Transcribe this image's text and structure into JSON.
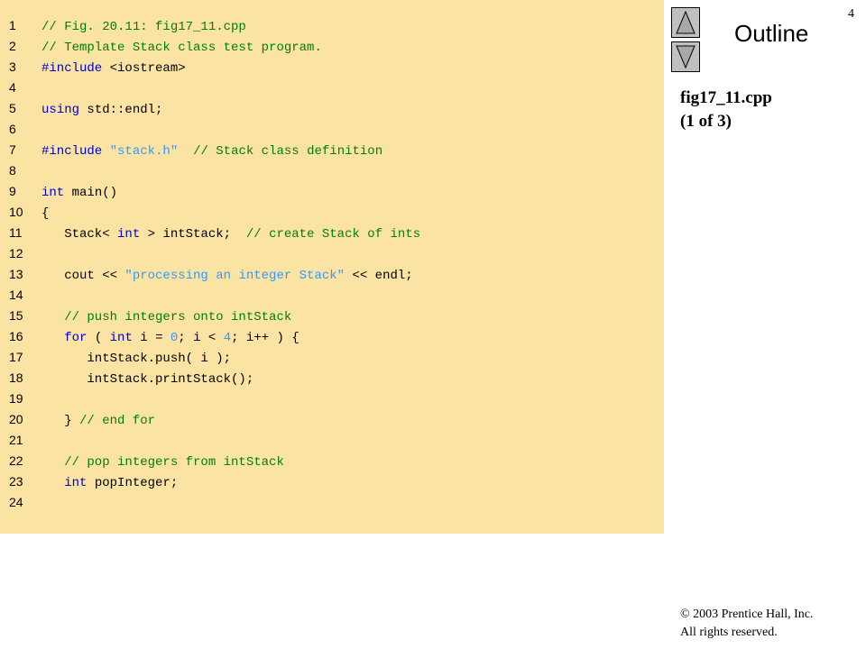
{
  "slide": {
    "number": "4",
    "outline_label": "Outline",
    "file_name": "fig17_11.cpp",
    "part": "(1 of 3)",
    "copyright_line1": "© 2003 Prentice Hall, Inc.",
    "copyright_line2": "All rights reserved."
  },
  "icons": {
    "up": "triangle-up-icon",
    "down": "triangle-down-icon"
  },
  "colors": {
    "panel_background": "#fbe3a3",
    "comment": "#008000",
    "keyword": "#0000cc",
    "string": "#3399ff",
    "number": "#3399ff",
    "button": "#c0c0c0"
  },
  "code_lines": [
    {
      "n": "1",
      "tokens": [
        {
          "t": "// Fig. 20.11: fig17_11.cpp",
          "c": "comment"
        }
      ]
    },
    {
      "n": "2",
      "tokens": [
        {
          "t": "// Template Stack class test program.",
          "c": "comment"
        }
      ]
    },
    {
      "n": "3",
      "tokens": [
        {
          "t": "#include",
          "c": "keyword"
        },
        {
          "t": " <iostream>",
          "c": "plain"
        }
      ]
    },
    {
      "n": "4",
      "tokens": []
    },
    {
      "n": "5",
      "tokens": [
        {
          "t": "using",
          "c": "keyword"
        },
        {
          "t": " std::endl;",
          "c": "plain"
        }
      ]
    },
    {
      "n": "6",
      "tokens": []
    },
    {
      "n": "7",
      "tokens": [
        {
          "t": "#include",
          "c": "keyword"
        },
        {
          "t": " ",
          "c": "plain"
        },
        {
          "t": "\"stack.h\"",
          "c": "string"
        },
        {
          "t": "  ",
          "c": "plain"
        },
        {
          "t": "// Stack class definition",
          "c": "comment"
        }
      ]
    },
    {
      "n": "8",
      "tokens": []
    },
    {
      "n": "9",
      "tokens": [
        {
          "t": "int",
          "c": "keyword"
        },
        {
          "t": " main()",
          "c": "plain"
        }
      ]
    },
    {
      "n": "10",
      "tokens": [
        {
          "t": "{",
          "c": "plain"
        }
      ]
    },
    {
      "n": "11",
      "tokens": [
        {
          "t": "   Stack< ",
          "c": "plain"
        },
        {
          "t": "int",
          "c": "keyword"
        },
        {
          "t": " > intStack;  ",
          "c": "plain"
        },
        {
          "t": "// create Stack of ints",
          "c": "comment"
        }
      ]
    },
    {
      "n": "12",
      "tokens": []
    },
    {
      "n": "13",
      "tokens": [
        {
          "t": "   cout << ",
          "c": "plain"
        },
        {
          "t": "\"processing an integer Stack\"",
          "c": "string"
        },
        {
          "t": " << endl;",
          "c": "plain"
        }
      ]
    },
    {
      "n": "14",
      "tokens": []
    },
    {
      "n": "15",
      "tokens": [
        {
          "t": "   // push integers onto intStack",
          "c": "comment"
        }
      ]
    },
    {
      "n": "16",
      "tokens": [
        {
          "t": "   ",
          "c": "plain"
        },
        {
          "t": "for",
          "c": "keyword"
        },
        {
          "t": " ( ",
          "c": "plain"
        },
        {
          "t": "int",
          "c": "keyword"
        },
        {
          "t": " i = ",
          "c": "plain"
        },
        {
          "t": "0",
          "c": "number"
        },
        {
          "t": "; i < ",
          "c": "plain"
        },
        {
          "t": "4",
          "c": "number"
        },
        {
          "t": "; i++ ) {",
          "c": "plain"
        }
      ]
    },
    {
      "n": "17",
      "tokens": [
        {
          "t": "      intStack.push( i );",
          "c": "plain"
        }
      ]
    },
    {
      "n": "18",
      "tokens": [
        {
          "t": "      intStack.printStack();",
          "c": "plain"
        }
      ]
    },
    {
      "n": "19",
      "tokens": []
    },
    {
      "n": "20",
      "tokens": [
        {
          "t": "   } ",
          "c": "plain"
        },
        {
          "t": "// end for",
          "c": "comment"
        }
      ]
    },
    {
      "n": "21",
      "tokens": []
    },
    {
      "n": "22",
      "tokens": [
        {
          "t": "   // pop integers from intStack",
          "c": "comment"
        }
      ]
    },
    {
      "n": "23",
      "tokens": [
        {
          "t": "   ",
          "c": "plain"
        },
        {
          "t": "int",
          "c": "keyword"
        },
        {
          "t": " popInteger;",
          "c": "plain"
        }
      ]
    },
    {
      "n": "24",
      "tokens": []
    }
  ]
}
